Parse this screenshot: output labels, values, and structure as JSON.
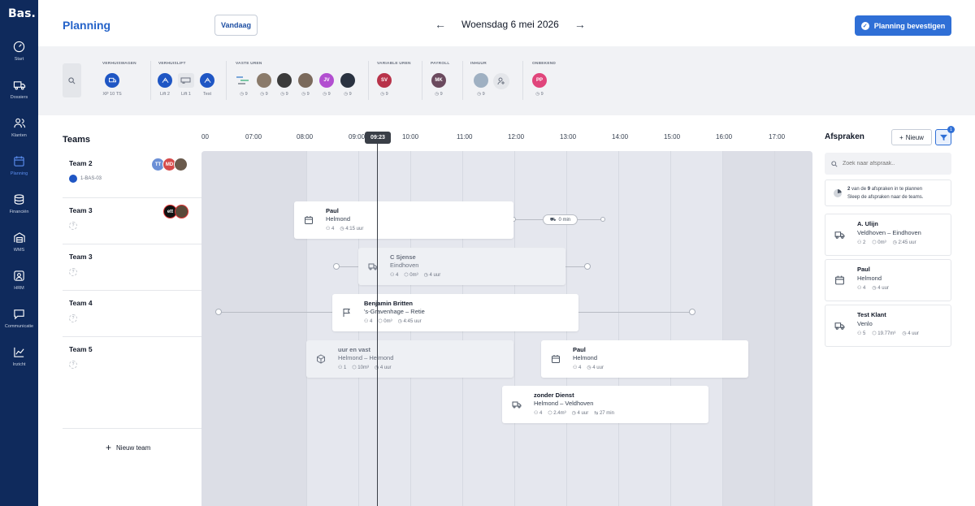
{
  "app": {
    "brand": "Bas.",
    "page_title": "Planning"
  },
  "sidebar": {
    "items": [
      {
        "label": "Start",
        "icon": "gauge-icon"
      },
      {
        "label": "Dossiers",
        "icon": "truck-icon"
      },
      {
        "label": "Klanten",
        "icon": "users-icon"
      },
      {
        "label": "Planning",
        "icon": "calendar-icon",
        "active": true
      },
      {
        "label": "Financiën",
        "icon": "coins-icon"
      },
      {
        "label": "WMS",
        "icon": "warehouse-icon"
      },
      {
        "label": "HRM",
        "icon": "person-icon"
      },
      {
        "label": "Communicatie",
        "icon": "chat-icon"
      },
      {
        "label": "Inzicht",
        "icon": "chart-icon"
      }
    ]
  },
  "header": {
    "today_label": "Vandaag",
    "date_label": "Woensdag 6 mei 2026",
    "confirm_label": "Planning bevestigen",
    "prev": "←",
    "next": "→"
  },
  "resources": {
    "groups": [
      "VERHUISWAGEN",
      "VERHUISLIFT",
      "VASTE UREN",
      "VARIABLE UREN",
      "PAYROLL",
      "INHUUR",
      "ONBEKEND"
    ],
    "verhuiswagen": [
      {
        "label": "XP 10 TS"
      }
    ],
    "verhuislift": [
      {
        "label": "Lift 2"
      },
      {
        "label": "Lift 1"
      },
      {
        "label": "Test"
      }
    ],
    "vaste_uren": [
      {
        "count": "9"
      },
      {
        "count": "9"
      },
      {
        "count": "9"
      },
      {
        "count": "9"
      },
      {
        "count": "9"
      },
      {
        "count": "9"
      }
    ],
    "vaste_uren_initials": {
      "jv": "JV"
    },
    "variable_uren": [
      {
        "initials": "SV",
        "count": "9"
      }
    ],
    "payroll": [
      {
        "initials": "MK",
        "count": "9"
      }
    ],
    "inhuur": [
      {
        "count": "9"
      }
    ],
    "onbekend": [
      {
        "initials": "PP",
        "count": "9"
      }
    ]
  },
  "timeline": {
    "teams_heading": "Teams",
    "hours": [
      "00",
      "07:00",
      "08:00",
      "09:00",
      "10:00",
      "11:00",
      "12:00",
      "13:00",
      "14:00",
      "15:00",
      "16:00",
      "17:00"
    ],
    "now": "09:23",
    "new_team": "Nieuw team"
  },
  "teams": [
    {
      "name": "Team 2",
      "sub": "1-BAS-03",
      "avatars": [
        "TT",
        "MD",
        ""
      ]
    },
    {
      "name": "Team 3",
      "sub": "?",
      "avatars": [
        "ett",
        ""
      ]
    },
    {
      "name": "Team 3",
      "sub": "?",
      "avatars": [
        "?",
        "?"
      ]
    },
    {
      "name": "Team 4",
      "sub": "?",
      "avatars": [
        "?",
        "?"
      ]
    },
    {
      "name": "Team 5",
      "sub": "?",
      "avatars": [
        "?",
        "?"
      ]
    }
  ],
  "jobs": [
    {
      "title": "Paul",
      "place": "Helmond",
      "people": "4",
      "duration": "4:15 uur"
    },
    {
      "title": "C Sjense",
      "place": "Eindhoven",
      "people": "4",
      "volume": "0m³",
      "duration": "4 uur"
    },
    {
      "title": "Benjamin Britten",
      "place": "'s-Gravenhage – Retie",
      "people": "4",
      "volume": "0m³",
      "duration": "4:45 uur"
    },
    {
      "title": "uur en vast",
      "place": "Helmond – Helmond",
      "people": "1",
      "volume": "10m³",
      "duration": "4 uur"
    },
    {
      "title": "Paul",
      "place": "Helmond",
      "people": "4",
      "duration": "4 uur"
    },
    {
      "title": "zonder Dienst",
      "place": "Helmond – Veldhoven",
      "people": "4",
      "volume": "2.4m³",
      "duration": "4 uur",
      "travel": "27 min"
    }
  ],
  "travel_pill": "0 min",
  "afspraken": {
    "heading": "Afspraken",
    "new_label": "Nieuw",
    "filter_badge": "1",
    "search_placeholder": "Zoek naar afspraak..",
    "info_count": "2",
    "info_mid": "van de",
    "info_total": "9",
    "info_rest": "afspraken in te plannen",
    "info_line2": "Sleep de afspraken naar de teams.",
    "items": [
      {
        "title": "A. Ulijn",
        "place": "Veldhoven – Eindhoven",
        "people": "2",
        "volume": "0m³",
        "duration": "2:45 uur"
      },
      {
        "title": "Paul",
        "place": "Helmond",
        "people": "4",
        "duration": "4 uur"
      },
      {
        "title": "Test Klant",
        "place": "Venlo",
        "people": "5",
        "volume": "19.77m³",
        "duration": "4 uur"
      }
    ]
  },
  "colors": {
    "sidebar": "#0f2a5c",
    "primary": "#2f6fd6",
    "sv": "#b8334a",
    "mk": "#6b4a5e",
    "pp": "#e0457b",
    "jv": "#b24fd0"
  }
}
